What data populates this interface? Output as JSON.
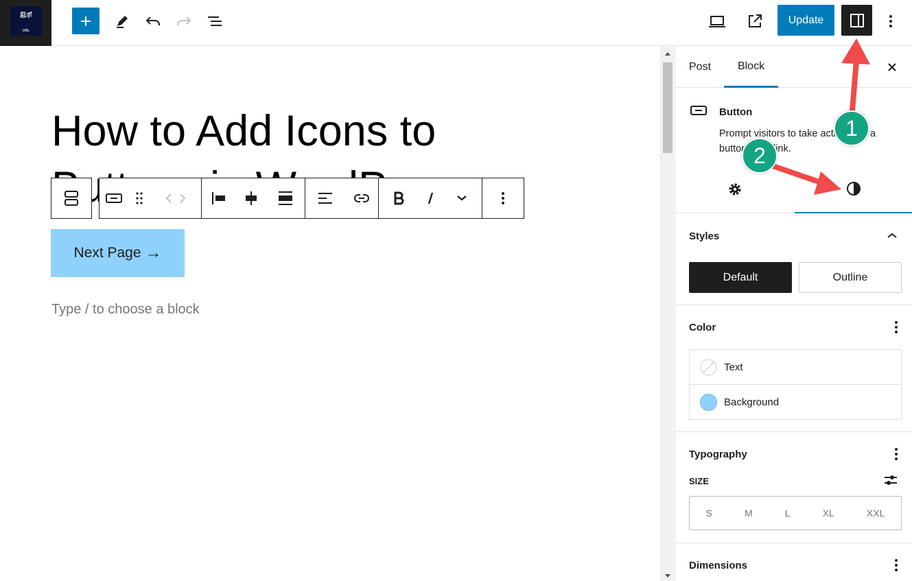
{
  "topbar": {
    "logo_text": "忍ポ",
    "logo_sub": "URL",
    "update_label": "Update"
  },
  "editor": {
    "title": "How to Add Icons to Buttons in WordPress",
    "next_button_label": "Next Page",
    "next_button_arrow": "→",
    "next_button_color": "#8ed1fc",
    "placeholder": "Type / to choose a block"
  },
  "sidebar": {
    "tabs": [
      {
        "label": "Post"
      },
      {
        "label": "Block"
      }
    ],
    "block": {
      "name": "Button",
      "description": "Prompt visitors to take action with a button-style link."
    },
    "styles": {
      "title": "Styles",
      "options": [
        "Default",
        "Outline"
      ]
    },
    "color": {
      "title": "Color",
      "items": [
        {
          "label": "Text",
          "swatch": "none"
        },
        {
          "label": "Background",
          "swatch": "#8ed1fc"
        }
      ]
    },
    "typography": {
      "title": "Typography",
      "size_label": "SIZE",
      "sizes": [
        "S",
        "M",
        "L",
        "XL",
        "XXL"
      ]
    },
    "dimensions": {
      "title": "Dimensions"
    }
  },
  "annotations": [
    "1",
    "2"
  ],
  "colors": {
    "accent": "#007cba",
    "annotation_green": "#14a483",
    "arrow_red": "#f04a4a"
  }
}
